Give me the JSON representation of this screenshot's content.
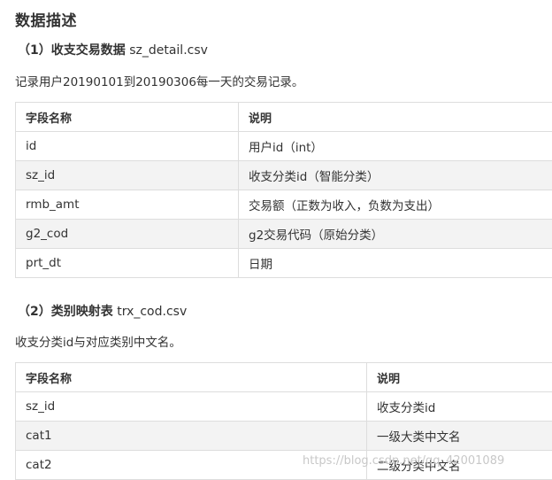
{
  "title": "数据描述",
  "section1": {
    "num": "（1）",
    "name": "收支交易数据",
    "file": " sz_detail.csv",
    "desc": "记录用户20190101到20190306每一天的交易记录。",
    "headers": [
      "字段名称",
      "说明"
    ],
    "rows": [
      [
        "id",
        "用户id（int）"
      ],
      [
        "sz_id",
        "收支分类id（智能分类）"
      ],
      [
        "rmb_amt",
        "交易额（正数为收入，负数为支出）"
      ],
      [
        "g2_cod",
        "g2交易代码（原始分类）"
      ],
      [
        "prt_dt",
        "日期"
      ]
    ]
  },
  "section2": {
    "num": "（2）",
    "name": "类别映射表",
    "file": " trx_cod.csv",
    "desc": "收支分类id与对应类别中文名。",
    "headers": [
      "字段名称",
      "说明"
    ],
    "rows": [
      [
        "sz_id",
        "收支分类id"
      ],
      [
        "cat1",
        "一级大类中文名"
      ],
      [
        "cat2",
        "二级分类中文名"
      ]
    ]
  },
  "watermark": "https://blog.csdn.net/qq_42001089"
}
